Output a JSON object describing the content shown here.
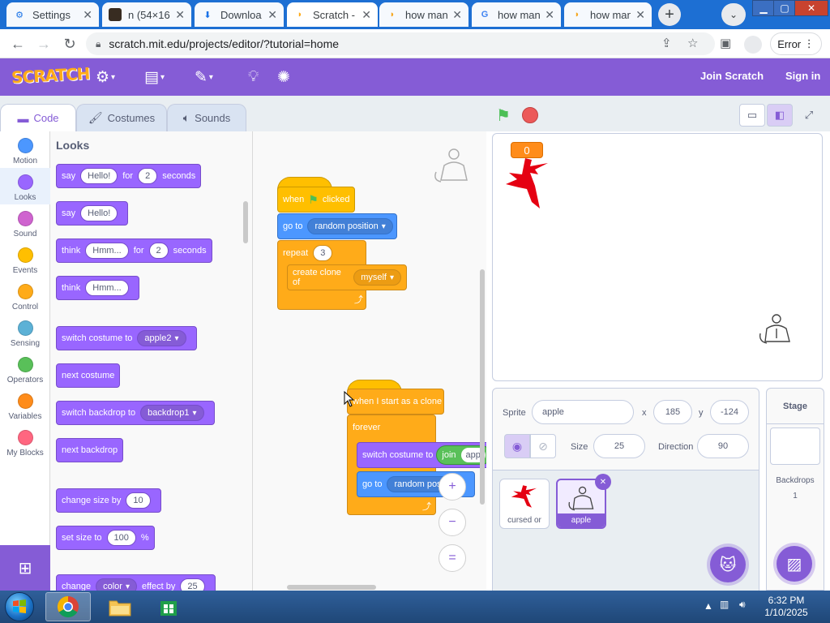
{
  "browser": {
    "tabs": [
      {
        "title": "Settings",
        "icon": "gear-icon",
        "active": false
      },
      {
        "title": "n (54×16",
        "icon": "image-icon",
        "active": false
      },
      {
        "title": "Downloa",
        "icon": "download-icon",
        "active": false
      },
      {
        "title": "Scratch -",
        "icon": "scratch-icon",
        "active": true
      },
      {
        "title": "how man",
        "icon": "scratch-icon",
        "active": false
      },
      {
        "title": "how man",
        "icon": "google-icon",
        "active": false
      },
      {
        "title": "how man",
        "icon": "scratch-icon",
        "active": false
      }
    ],
    "url": "scratch.mit.edu/projects/editor/?tutorial=home",
    "error_label": "Error"
  },
  "menubar": {
    "logo": "SCRATCH",
    "join": "Join Scratch",
    "signin": "Sign in"
  },
  "editor_tabs": {
    "code": "Code",
    "costumes": "Costumes",
    "sounds": "Sounds"
  },
  "categories": [
    {
      "label": "Motion",
      "color": "#4c97ff"
    },
    {
      "label": "Looks",
      "color": "#9966ff"
    },
    {
      "label": "Sound",
      "color": "#cf63cf"
    },
    {
      "label": "Events",
      "color": "#ffbf00"
    },
    {
      "label": "Control",
      "color": "#ffab19"
    },
    {
      "label": "Sensing",
      "color": "#5cb1d6"
    },
    {
      "label": "Operators",
      "color": "#59c059"
    },
    {
      "label": "Variables",
      "color": "#ff8c1a"
    },
    {
      "label": "My Blocks",
      "color": "#ff6680"
    }
  ],
  "palette": {
    "title": "Looks",
    "say_for": {
      "say": "say",
      "msg": "Hello!",
      "for": "for",
      "secs": "2",
      "seconds": "seconds"
    },
    "say": {
      "say": "say",
      "msg": "Hello!"
    },
    "think_for": {
      "think": "think",
      "msg": "Hmm...",
      "for": "for",
      "secs": "2",
      "seconds": "seconds"
    },
    "think": {
      "think": "think",
      "msg": "Hmm..."
    },
    "switch_costume": {
      "label": "switch costume to",
      "value": "apple2"
    },
    "next_costume": "next costume",
    "switch_backdrop": {
      "label": "switch backdrop to",
      "value": "backdrop1"
    },
    "next_backdrop": "next backdrop",
    "change_size": {
      "label": "change size by",
      "value": "10"
    },
    "set_size": {
      "label": "set size to",
      "value": "100",
      "unit": "%"
    },
    "change_effect": {
      "label": "change",
      "effect": "color",
      "by": "effect by",
      "value": "25"
    }
  },
  "script1": {
    "when_flag": "when",
    "clicked": "clicked",
    "goto": "go to",
    "goto_value": "random position",
    "repeat": "repeat",
    "repeat_value": "3",
    "create_clone": "create clone of",
    "create_clone_value": "myself"
  },
  "script2": {
    "hat": "when I start as a clone",
    "forever": "forever",
    "switch_costume": "switch costume to",
    "join": "join",
    "join_value": "app",
    "goto": "go to",
    "goto_value": "random posi"
  },
  "zoom": {
    "in": "+",
    "out": "−",
    "reset": "="
  },
  "stage": {
    "monitor_value": "0"
  },
  "sprite_info": {
    "sprite_label": "Sprite",
    "sprite_name": "apple",
    "x_label": "x",
    "x_value": "185",
    "y_label": "y",
    "y_value": "-124",
    "show_label": "Show",
    "size_label": "Size",
    "size_value": "25",
    "direction_label": "Direction",
    "direction_value": "90"
  },
  "sprites": [
    {
      "name": "cursed or",
      "selected": false
    },
    {
      "name": "apple",
      "selected": true
    }
  ],
  "stage_pane": {
    "title": "Stage",
    "backdrops_label": "Backdrops",
    "backdrops_count": "1"
  },
  "taskbar": {
    "time": "6:32 PM",
    "date": "1/10/2025"
  }
}
